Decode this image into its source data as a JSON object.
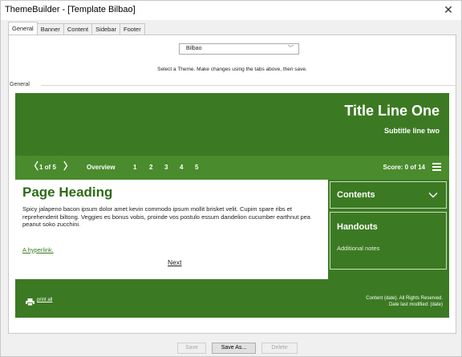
{
  "window": {
    "title": "ThemeBuilder - [Template Bilbao]"
  },
  "tabs": [
    "General",
    "Banner",
    "Content",
    "Sidebar",
    "Footer"
  ],
  "theme": {
    "selected": "Bilbao",
    "instruction": "Select a Theme. Make changes using the tabs above, then save."
  },
  "group_label": "General",
  "preview": {
    "title": "Title Line One",
    "subtitle": "Subtitle line two",
    "nav": {
      "prev": "〈",
      "count": "1 of 5",
      "next": "〉",
      "overview": "Overview",
      "pages": [
        "1",
        "2",
        "3",
        "4",
        "5"
      ],
      "score": "Score: 0 of 14"
    },
    "page_heading": "Page Heading",
    "body_text": "Spicy jalapeno bacon ipsum dolor amet kevin commodo ipsum mollit brisket velit. Cupim spare ribs et reprehenderit biltong. Veggies es bonus vobis, proinde vos postulo essum dandelion cucumber earthnut pea peanut soko zucchini.",
    "hyperlink": "A hyperlink.",
    "next_link": "Next",
    "sidebar": {
      "contents": "Contents",
      "handouts": "Handouts",
      "notes": "Additional notes"
    },
    "footer": {
      "print": "print all",
      "copyright": "Content (date). All Rights Reserved.",
      "modified": "Date last modified: (date)"
    }
  },
  "buttons": {
    "save": "Save",
    "save_as": "Save As...",
    "delete": "Delete"
  },
  "colors": {
    "brand_green": "#3b7a22",
    "nav_green": "#4a8b2d",
    "heading_green": "#2e6b17"
  }
}
